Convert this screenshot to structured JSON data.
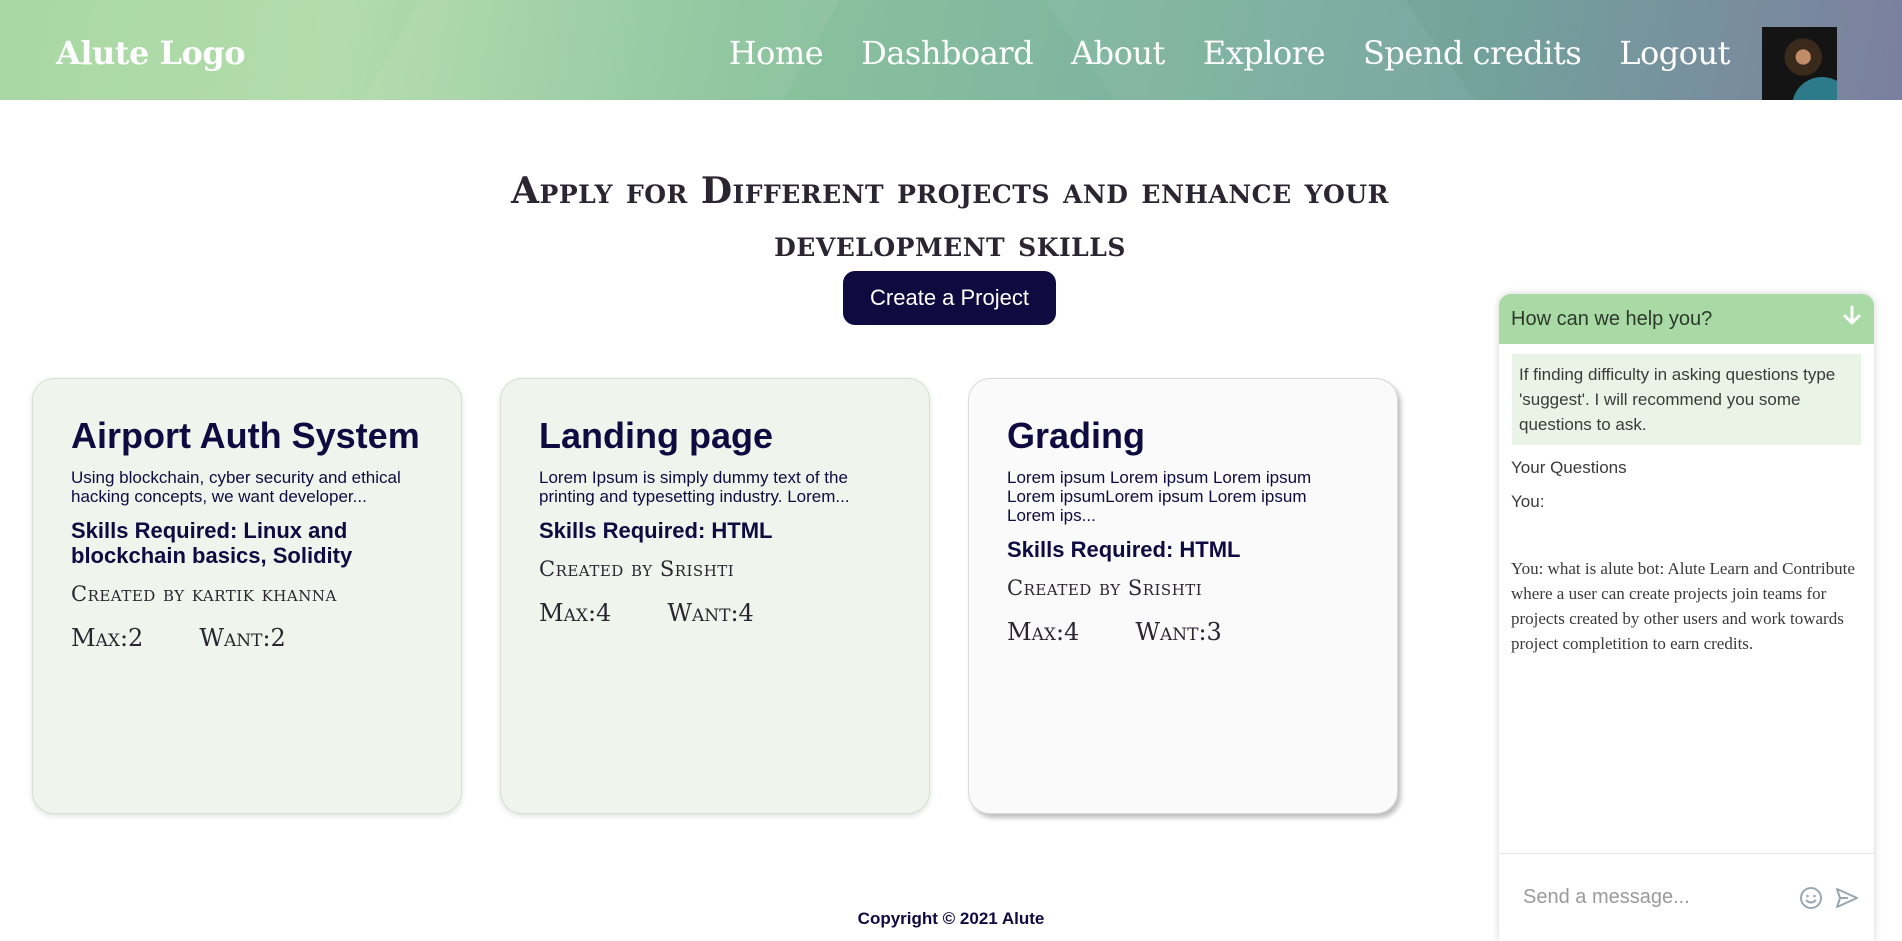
{
  "header": {
    "logo": "Alute Logo",
    "nav": [
      "Home",
      "Dashboard",
      "About",
      "Explore",
      "Spend credits",
      "Logout"
    ]
  },
  "hero": {
    "title": "Apply for Different projects and enhance your development skills",
    "create_button": "Create a Project"
  },
  "projects": [
    {
      "title": "Airport Auth System",
      "description": "Using blockchain, cyber security and ethical hacking concepts, we want developer...",
      "skills": "Skills Required: Linux and blockchain basics, Solidity",
      "creator": "Created by kartik khanna",
      "max": "Max:2",
      "want": "Want:2"
    },
    {
      "title": "Landing page",
      "description": "Lorem Ipsum is simply dummy text of the printing and typesetting industry. Lorem...",
      "skills": "Skills Required: HTML",
      "creator": "Created by Srishti",
      "max": "Max:4",
      "want": "Want:4"
    },
    {
      "title": "Grading",
      "description": "Lorem ipsum Lorem ipsum Lorem ipsum Lorem ipsumLorem ipsum Lorem ipsum Lorem ips...",
      "skills": "Skills Required: HTML",
      "creator": "Created by Srishti",
      "max": "Max:4",
      "want": "Want:3"
    }
  ],
  "footer": {
    "copyright": "Copyright © 2021 Alute"
  },
  "chat": {
    "title": "How can we help you?",
    "bot_message": "If finding difficulty in asking questions type 'suggest'. I will recommend you some questions to ask.",
    "your_questions": "Your Questions",
    "you_label": "You:",
    "you_answer": "You: what is alute bot: Alute Learn and Contribute where a user can create projects join teams for projects created by other users and work towards project completition to earn credits.",
    "input_placeholder": "Send a message..."
  },
  "colors": {
    "primary": "#0f0a40",
    "chat_header": "#a9d9a4",
    "card_green": "#eff5ec"
  }
}
